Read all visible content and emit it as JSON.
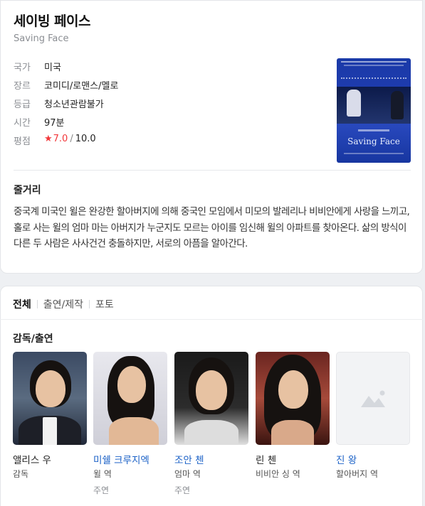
{
  "movie": {
    "title": "세이빙 페이스",
    "original_title": "Saving Face",
    "info": [
      {
        "label": "국가",
        "value": "미국"
      },
      {
        "label": "장르",
        "value": "코미디/로맨스/멜로"
      },
      {
        "label": "등급",
        "value": "청소년관람불가"
      },
      {
        "label": "시간",
        "value": "97분"
      }
    ],
    "rating": {
      "label": "평점",
      "star": "★",
      "value": "7.0",
      "separator": "/",
      "max": "10.0"
    },
    "poster": {
      "title_text": "Saving Face",
      "icon": "movie-poster"
    }
  },
  "synopsis": {
    "heading": "줄거리",
    "text": "중국계 미국인 윌은 완강한 할아버지에 의해 중국인 모임에서 미모의 발레리나 비비안에게 사랑을 느끼고, 홀로 사는 윌의 엄마 마는 아버지가 누군지도 모르는 아이를 임신해 윌의 아파트를 찾아온다. 삶의 방식이 다른 두 사람은 사사건건 충돌하지만, 서로의 아픔을 알아간다."
  },
  "tabs": [
    {
      "label": "전체",
      "active": true
    },
    {
      "label": "출연/제작",
      "active": false
    },
    {
      "label": "포토",
      "active": false
    }
  ],
  "cast_section": {
    "heading": "감독/출연",
    "people": [
      {
        "name": "앨리스 우",
        "role": "감독",
        "category": "",
        "link": false
      },
      {
        "name": "미쉘 크루지엑",
        "role": "윌 역",
        "category": "주연",
        "link": true
      },
      {
        "name": "조안 첸",
        "role": "엄마 역",
        "category": "주연",
        "link": true
      },
      {
        "name": "린 첸",
        "role": "비비안 싱 역",
        "category": "",
        "link": false
      },
      {
        "name": "진 왕",
        "role": "할아버지 역",
        "category": "",
        "link": true
      }
    ]
  },
  "colors": {
    "accent_link": "#1c62c7",
    "rating_red": "#f2373a",
    "muted": "#8b8e93"
  }
}
